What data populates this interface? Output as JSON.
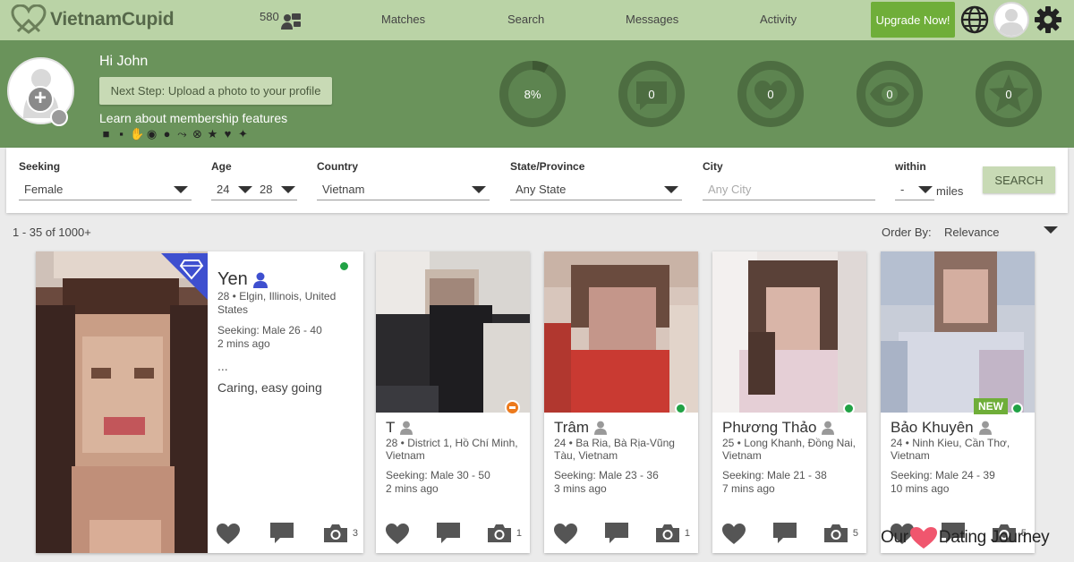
{
  "brand": {
    "name": "VietnamCupid",
    "color": "#56684a",
    "accent": "#6fae39"
  },
  "nav": {
    "interest_count": "580",
    "items": [
      "Matches",
      "Search",
      "Messages",
      "Activity"
    ],
    "upgrade_label": "Upgrade Now!"
  },
  "hero": {
    "greeting": "Hi John",
    "next_step": "Next Step: Upload a photo to your profile",
    "learn_link": "Learn about membership features",
    "stats": [
      {
        "icon": "progress-ring",
        "value": "8%",
        "progress": 0.08
      },
      {
        "icon": "message-icon",
        "value": "0"
      },
      {
        "icon": "heart-icon",
        "value": "0"
      },
      {
        "icon": "eye-icon",
        "value": "0"
      },
      {
        "icon": "star-icon",
        "value": "0"
      }
    ]
  },
  "search": {
    "seeking_label": "Seeking",
    "seeking_value": "Female",
    "age_label": "Age",
    "age_min": "24",
    "age_max": "28",
    "country_label": "Country",
    "country_value": "Vietnam",
    "state_label": "State/Province",
    "state_value": "Any State",
    "city_label": "City",
    "city_placeholder": "Any City",
    "within_label": "within",
    "within_value": "-",
    "within_unit": "miles",
    "button": "SEARCH"
  },
  "results": {
    "count": "1 - 35 of 1000+",
    "order_label": "Order By:",
    "order_value": "Relevance"
  },
  "featured": {
    "name": "Yen",
    "meta": "28 • Elgin, Illinois, United States",
    "seeking": "Seeking: Male 26 - 40",
    "last_active": "2 mins ago",
    "dots": "...",
    "bio": "Caring, easy going",
    "photos": "3",
    "online": true
  },
  "profiles": [
    {
      "name": "T",
      "meta": "28 • District 1, Hồ Chí Minh, Vietnam",
      "seeking": "Seeking: Male 30 - 50",
      "last_active": "2 mins ago",
      "photos": "1",
      "status": "away"
    },
    {
      "name": "Trâm",
      "meta": "24 • Ba Ria, Bà Rịa-Vũng Tàu, Vietnam",
      "seeking": "Seeking: Male 23 - 36",
      "last_active": "3 mins ago",
      "photos": "1",
      "status": "online"
    },
    {
      "name": "Phương Thảo",
      "meta": "25 • Long Khanh, Đồng Nai, Vietnam",
      "seeking": "Seeking: Male 21 - 38",
      "last_active": "7 mins ago",
      "photos": "5",
      "status": "online"
    },
    {
      "name": "Bảo Khuyên",
      "meta": "24 • Ninh Kieu, Cần Thơ, Vietnam",
      "seeking": "Seeking: Male 24 - 39",
      "last_active": "10 mins ago",
      "photos": "5",
      "status": "online",
      "badge": "NEW"
    }
  ],
  "watermark": {
    "left": "Our",
    "right": "Dating Journey"
  }
}
